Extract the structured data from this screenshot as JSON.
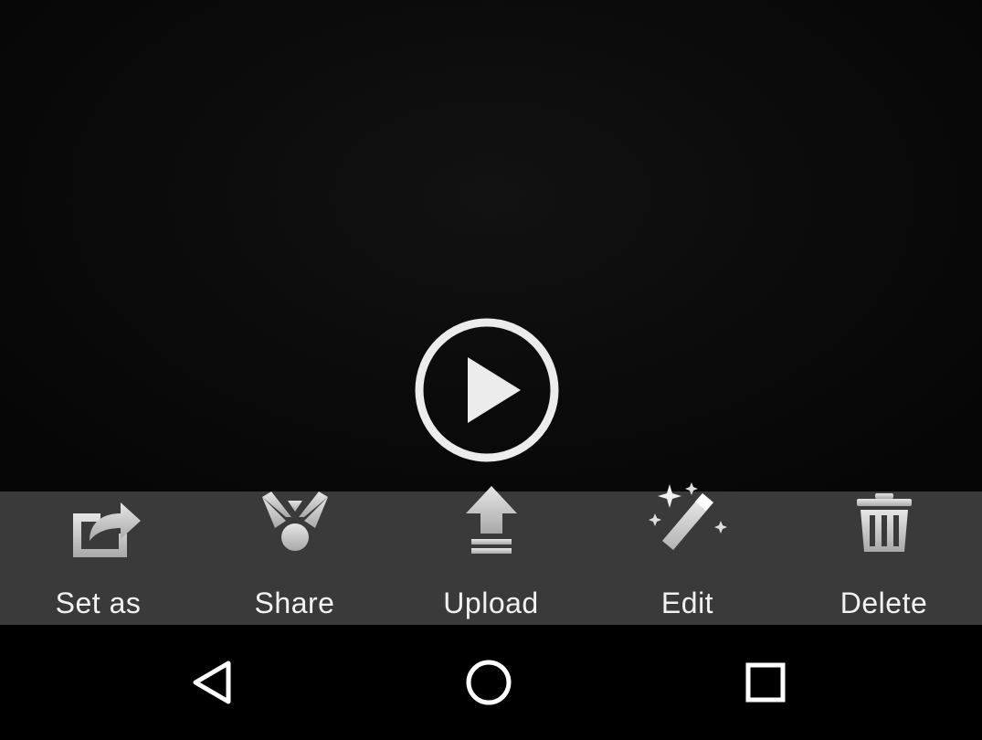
{
  "player": {
    "play_icon": "play-circle-icon"
  },
  "actions": [
    {
      "label": "Set as",
      "icon": "set-as-icon"
    },
    {
      "label": "Share",
      "icon": "share-icon"
    },
    {
      "label": "Upload",
      "icon": "upload-icon"
    },
    {
      "label": "Edit",
      "icon": "magic-wand-icon"
    },
    {
      "label": "Delete",
      "icon": "trash-icon"
    }
  ],
  "navigation": {
    "back_icon": "back-triangle-icon",
    "home_icon": "home-circle-icon",
    "recents_icon": "recents-square-icon"
  },
  "colors": {
    "action_bar_background": "#3a3a3a",
    "icon_gray": "#d0d0d0",
    "label_text": "#f2f2f2",
    "navigation_background": "#000000"
  }
}
